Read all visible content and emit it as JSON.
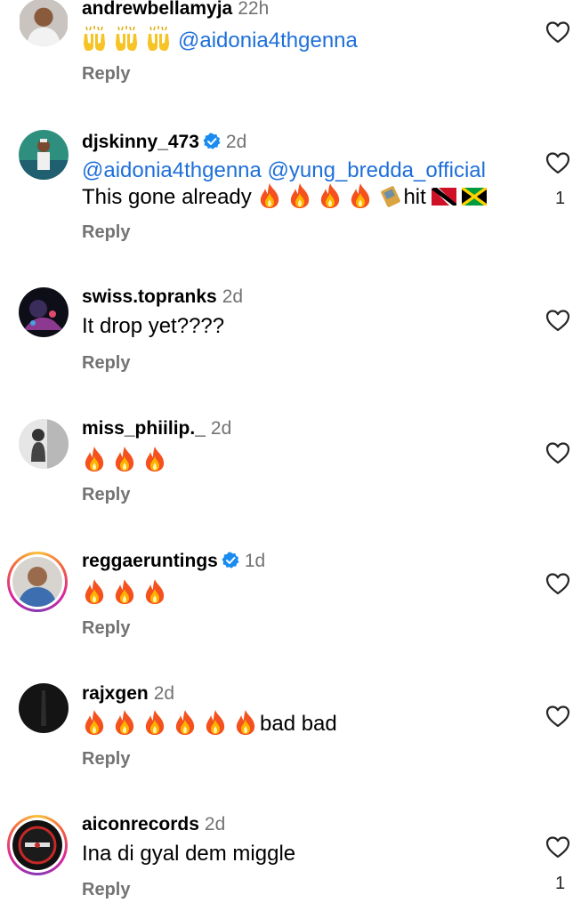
{
  "comments": [
    {
      "username": "andrewbellamyja",
      "time": "22h",
      "mention": "@aidonia4thgenna",
      "reply": "Reply",
      "avatar": "avatar-icon"
    },
    {
      "username": "djskinny_473",
      "time": "2d",
      "mentions": "@aidonia4thgenna @yung_bredda_official",
      "text": "This gone already",
      "text_tail": "hit",
      "likes": "1",
      "reply": "Reply"
    },
    {
      "username": "swiss.topranks",
      "time": "2d",
      "text": "It drop yet????",
      "reply": "Reply"
    },
    {
      "username": "miss_phiilip._",
      "time": "2d",
      "reply": "Reply"
    },
    {
      "username": "reggaeruntings",
      "time": "1d",
      "reply": "Reply"
    },
    {
      "username": "rajxgen",
      "time": "2d",
      "text": "bad bad",
      "reply": "Reply"
    },
    {
      "username": "aiconrecords",
      "time": "2d",
      "text": "Ina di gyal dem miggle",
      "likes": "1",
      "reply": "Reply"
    }
  ],
  "icons": {
    "heart": "heart-outline-icon",
    "fire": "fire-emoji",
    "hands": "raising-hands-emoji",
    "verified": "verified-badge-icon",
    "flags": [
      "trinidad-tobago-flag",
      "jamaica-flag"
    ]
  },
  "colors": {
    "mention": "#1e6fd9",
    "verified": "#1a8cf0",
    "muted": "#737373"
  }
}
